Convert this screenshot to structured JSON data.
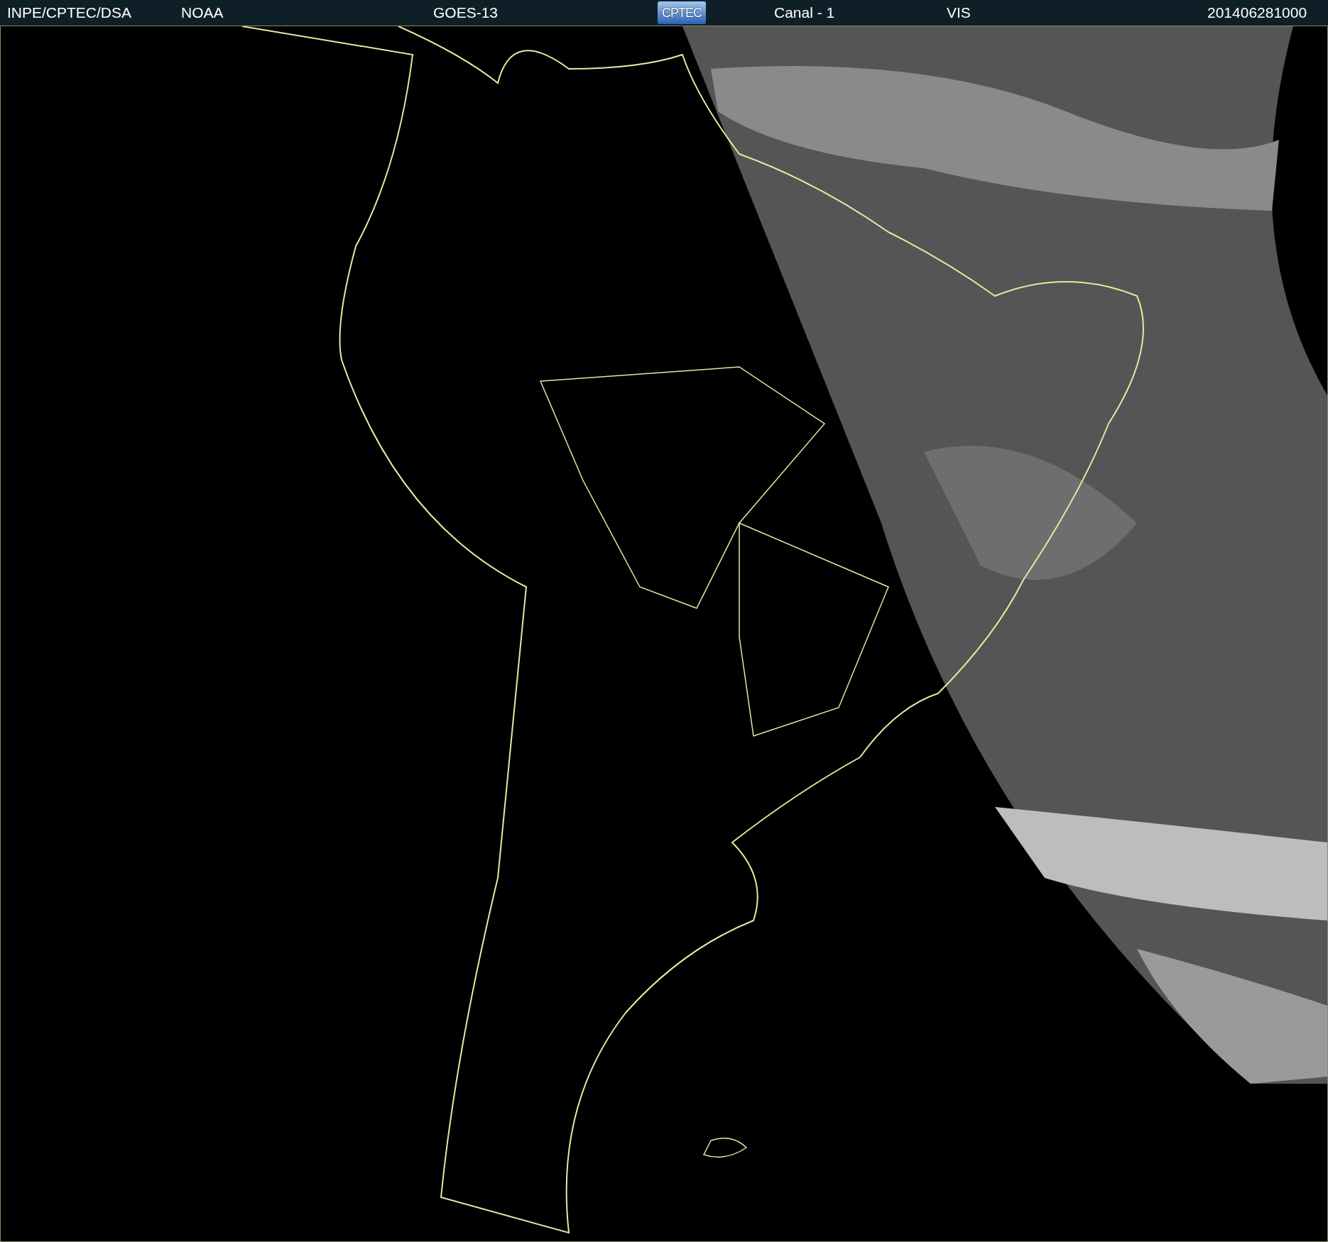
{
  "header": {
    "source": "INPE/CPTEC/DSA",
    "agency": "NOAA",
    "satellite": "GOES-13",
    "logo": "CPTEC",
    "channel": "Canal - 1",
    "band": "VIS",
    "timestamp": "201406281000"
  }
}
